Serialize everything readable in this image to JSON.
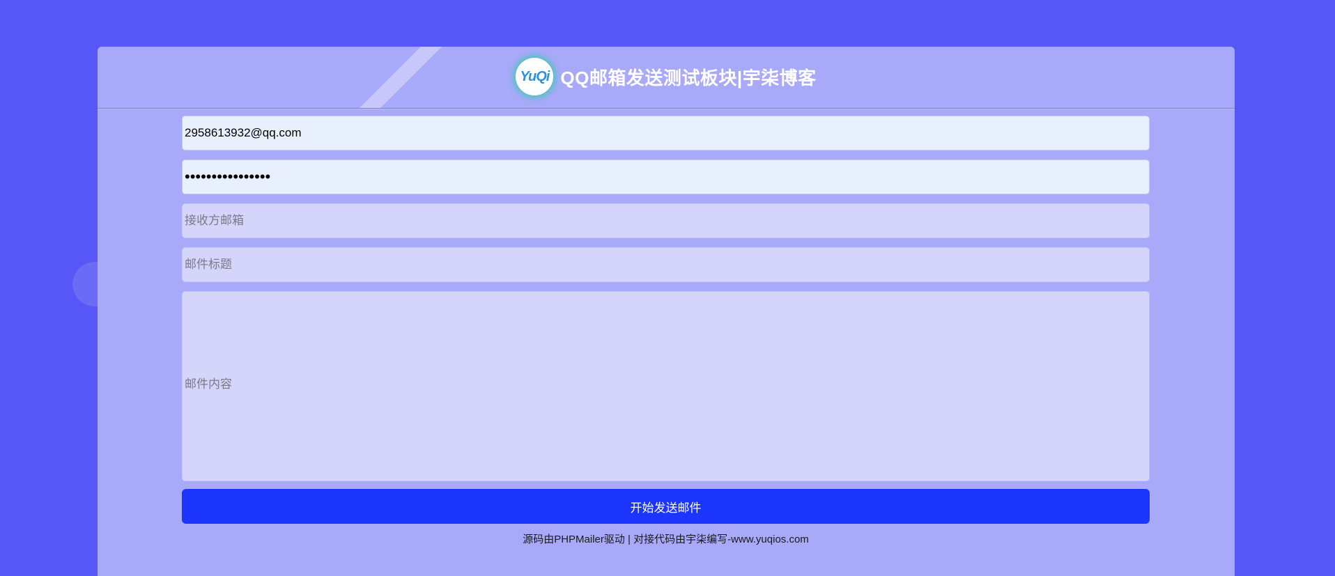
{
  "header": {
    "logo_text": "YuQi",
    "title": "QQ邮箱发送测试板块|宇柒博客"
  },
  "form": {
    "sender_email": {
      "value": "2958613932@qq.com"
    },
    "auth_code": {
      "value": "••••••••••••••••"
    },
    "recipient": {
      "placeholder": "接收方邮箱"
    },
    "subject": {
      "placeholder": "邮件标题"
    },
    "content": {
      "placeholder": "邮件内容"
    },
    "submit_label": "开始发送邮件"
  },
  "footer": {
    "text": "源码由PHPMailer驱动 | 对接代码由宇柒编写-www.yuqios.com"
  },
  "colors": {
    "page_bg": "#5657f6",
    "card_bg": "#a9a9fa",
    "button_bg": "#1c35fc",
    "logo_glow": "#3fc8b4"
  }
}
